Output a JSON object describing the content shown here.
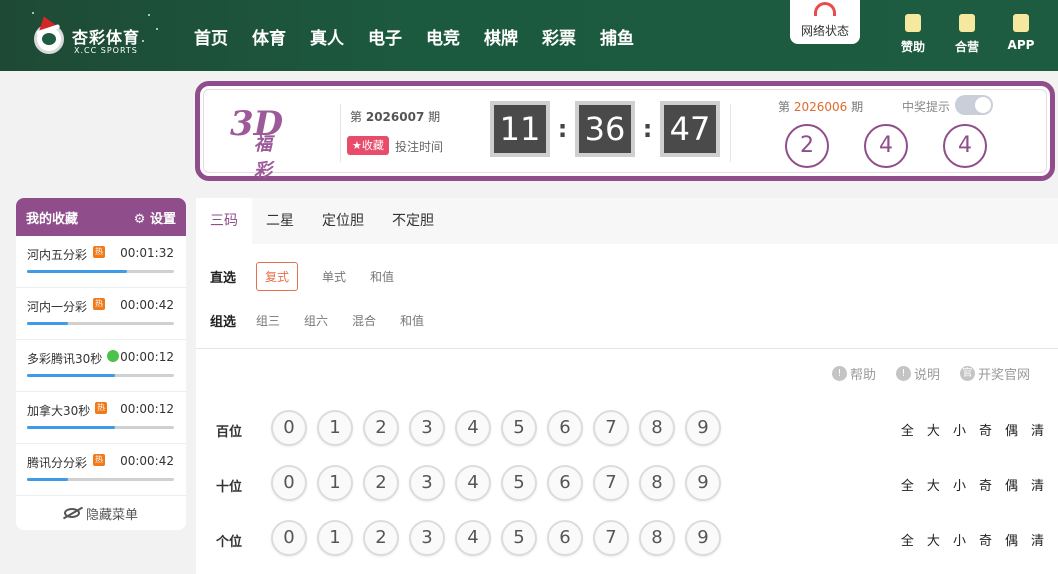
{
  "brand": {
    "name": "杏彩体育",
    "sub": "X.CC SPORTS"
  },
  "nav": [
    "首页",
    "体育",
    "真人",
    "电子",
    "电竞",
    "棋牌",
    "彩票",
    "捕鱼"
  ],
  "network": {
    "label": "网络状态"
  },
  "header_links": [
    {
      "icon": "sponsor-icon",
      "label": "赞助"
    },
    {
      "icon": "partner-icon",
      "label": "合营"
    },
    {
      "icon": "app-icon",
      "label": "APP"
    }
  ],
  "lottery": {
    "logo_main": "3D",
    "logo_sub": "福彩",
    "issue_prefix": "第",
    "current_issue": "2026007",
    "issue_suffix": "期",
    "favorite_label": "收藏",
    "bet_time_label": "投注时间",
    "countdown": {
      "h": "11",
      "m": "36",
      "s": "47"
    },
    "last_issue": "2026006",
    "prize_tip_label": "中奖提示",
    "result": [
      "2",
      "4",
      "4"
    ]
  },
  "sidebar": {
    "title": "我的收藏",
    "settings_label": "设置",
    "items": [
      {
        "name": "河内五分彩",
        "hot": "热",
        "time": "00:01:32",
        "progress": 0.68
      },
      {
        "name": "河内一分彩",
        "hot": "热",
        "time": "00:00:42",
        "progress": 0.28
      },
      {
        "name": "多彩腾讯30秒",
        "hot": "",
        "time": "00:00:12",
        "progress": 0.6
      },
      {
        "name": "加拿大30秒",
        "hot": "热",
        "time": "00:00:12",
        "progress": 0.6
      },
      {
        "name": "腾讯分分彩",
        "hot": "热",
        "time": "00:00:42",
        "progress": 0.28
      }
    ],
    "hide_menu_label": "隐藏菜单"
  },
  "tabs": [
    "三码",
    "二星",
    "定位胆",
    "不定胆"
  ],
  "play": {
    "direct_label": "直选",
    "direct_options": [
      "复式",
      "单式",
      "和值"
    ],
    "group_label": "组选",
    "group_options": [
      "组三",
      "组六",
      "混合",
      "和值"
    ]
  },
  "help_links": [
    "帮助",
    "说明",
    "开奖官网"
  ],
  "digits": {
    "rows": [
      "百位",
      "十位",
      "个位"
    ],
    "balls": [
      "0",
      "1",
      "2",
      "3",
      "4",
      "5",
      "6",
      "7",
      "8",
      "9"
    ],
    "controls": [
      "全",
      "大",
      "小",
      "奇",
      "偶",
      "清"
    ]
  },
  "colors": {
    "header": "#1d5a3f",
    "accent": "#8f4e8b",
    "highlight": "#e8704d",
    "progress": "#3d9be8"
  }
}
